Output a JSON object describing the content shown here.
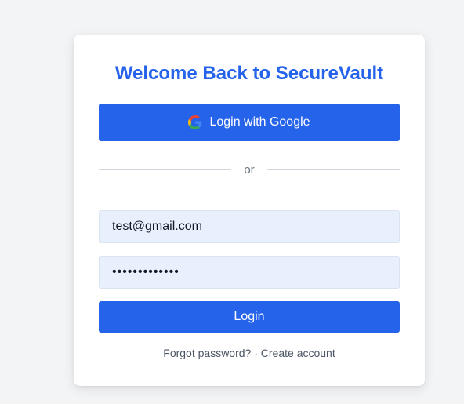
{
  "login": {
    "title": "Welcome Back to SecureVault",
    "google_button": "Login with Google",
    "google_icon": "google-icon",
    "divider_text": "or",
    "email_value": "test@gmail.com",
    "password_value": "•••••••••••••",
    "login_button": "Login",
    "forgot_password": "Forgot password?",
    "separator": " · ",
    "create_account": "Create account"
  },
  "colors": {
    "primary": "#2563eb",
    "background": "#f3f4f6",
    "input_bg": "#e8f0fe",
    "muted_text": "#4b5563"
  }
}
